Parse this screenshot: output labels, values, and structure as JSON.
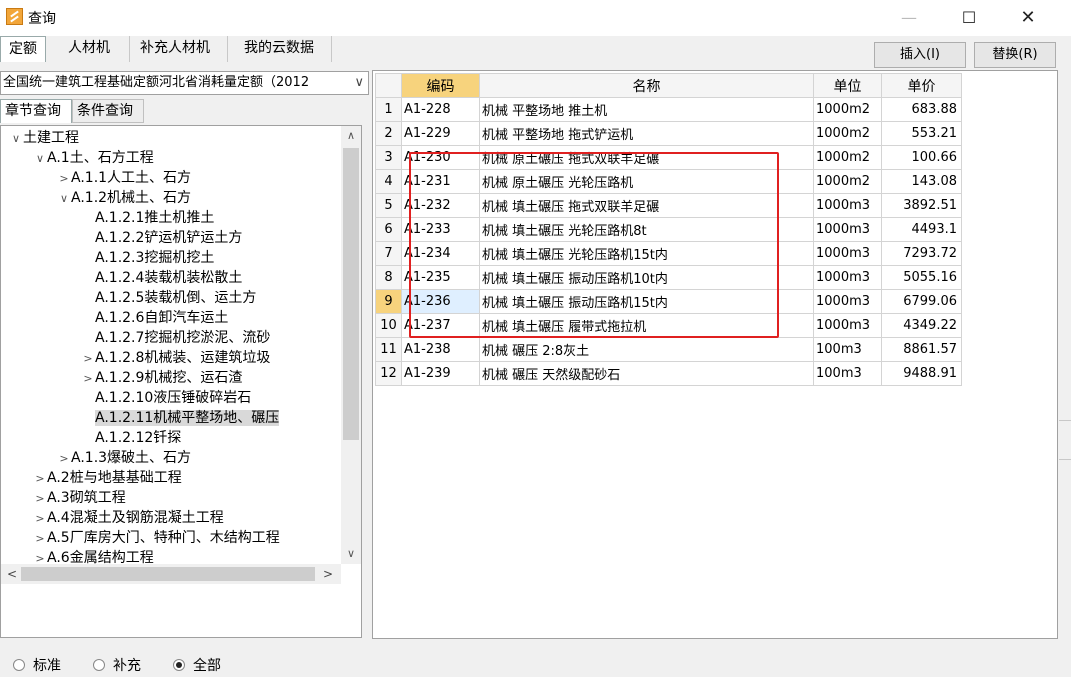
{
  "window": {
    "title": "查询",
    "minimize": "—",
    "maximize": "☐",
    "close": "✕"
  },
  "top_tabs": [
    "定额",
    "人材机",
    "补充人材机",
    "我的云数据"
  ],
  "actions": {
    "insert": "插入(I)",
    "replace": "替换(R)"
  },
  "left": {
    "quota_select": "全国统一建筑工程基础定额河北省消耗量定额（2012",
    "sub_tabs": [
      "章节查询",
      "条件查询"
    ],
    "tree": [
      {
        "label": "土建工程",
        "toggle": "∨"
      },
      {
        "label": "A.1土、石方工程",
        "toggle": "∨"
      },
      {
        "label": "A.1.1人工土、石方",
        "toggle": ">"
      },
      {
        "label": "A.1.2机械土、石方",
        "toggle": "∨"
      },
      {
        "label": "A.1.2.1推土机推土",
        "toggle": ""
      },
      {
        "label": "A.1.2.2铲运机铲运土方",
        "toggle": ""
      },
      {
        "label": "A.1.2.3挖掘机挖土",
        "toggle": ""
      },
      {
        "label": "A.1.2.4装载机装松散土",
        "toggle": ""
      },
      {
        "label": "A.1.2.5装载机倒、运土方",
        "toggle": ""
      },
      {
        "label": "A.1.2.6自卸汽车运土",
        "toggle": ""
      },
      {
        "label": "A.1.2.7挖掘机挖淤泥、流砂",
        "toggle": ""
      },
      {
        "label": "A.1.2.8机械装、运建筑垃圾",
        "toggle": ">"
      },
      {
        "label": "A.1.2.9机械挖、运石渣",
        "toggle": ">"
      },
      {
        "label": "A.1.2.10液压锤破碎岩石",
        "toggle": ""
      },
      {
        "label": "A.1.2.11机械平整场地、碾压",
        "toggle": ""
      },
      {
        "label": "A.1.2.12钎探",
        "toggle": ""
      },
      {
        "label": "A.1.3爆破土、石方",
        "toggle": ">"
      },
      {
        "label": "A.2桩与地基基础工程",
        "toggle": ">"
      },
      {
        "label": "A.3砌筑工程",
        "toggle": ">"
      },
      {
        "label": "A.4混凝土及钢筋混凝土工程",
        "toggle": ">"
      },
      {
        "label": "A.5厂库房大门、特种门、木结构工程",
        "toggle": ">"
      },
      {
        "label": "A.6金属结构工程",
        "toggle": ">"
      }
    ],
    "radios": [
      "标准",
      "补充",
      "全部"
    ],
    "radio_selected": "全部"
  },
  "table": {
    "headers": [
      "",
      "编码",
      "名称",
      "单位",
      "单价"
    ],
    "rows": [
      [
        "1",
        "A1-228",
        "机械 平整场地 推土机",
        "1000m2",
        "683.88"
      ],
      [
        "2",
        "A1-229",
        "机械 平整场地 拖式铲运机",
        "1000m2",
        "553.21"
      ],
      [
        "3",
        "A1-230",
        "机械 原土碾压 拖式双联羊足碾",
        "1000m2",
        "100.66"
      ],
      [
        "4",
        "A1-231",
        "机械 原土碾压 光轮压路机",
        "1000m2",
        "143.08"
      ],
      [
        "5",
        "A1-232",
        "机械 填土碾压 拖式双联羊足碾",
        "1000m3",
        "3892.51"
      ],
      [
        "6",
        "A1-233",
        "机械 填土碾压 光轮压路机8t",
        "1000m3",
        "4493.1"
      ],
      [
        "7",
        "A1-234",
        "机械 填土碾压 光轮压路机15t内",
        "1000m3",
        "7293.72"
      ],
      [
        "8",
        "A1-235",
        "机械 填土碾压 振动压路机10t内",
        "1000m3",
        "5055.16"
      ],
      [
        "9",
        "A1-236",
        "机械 填土碾压 振动压路机15t内",
        "1000m3",
        "6799.06"
      ],
      [
        "10",
        "A1-237",
        "机械 填土碾压 履带式拖拉机",
        "1000m3",
        "4349.22"
      ],
      [
        "11",
        "A1-238",
        "机械 碾压 2:8灰土",
        "100m3",
        "8861.57"
      ],
      [
        "12",
        "A1-239",
        "机械 碾压 天然级配砂石",
        "100m3",
        "9488.91"
      ]
    ],
    "current_row": "9"
  }
}
